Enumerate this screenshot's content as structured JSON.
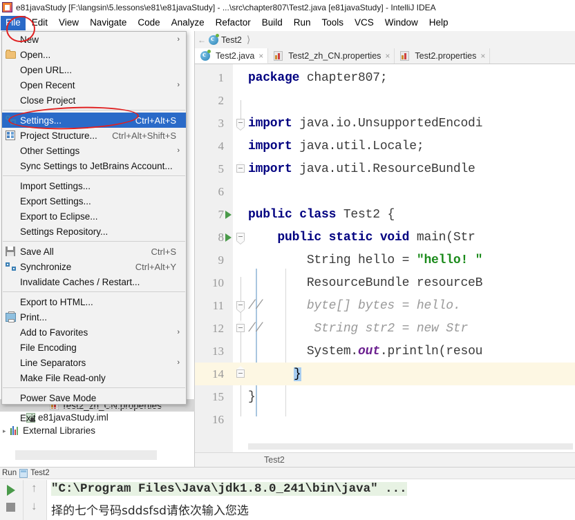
{
  "window": {
    "title": "e81javaStudy [F:\\langsin\\5.lessons\\e81\\e81javaStudy] - ...\\src\\chapter807\\Test2.java [e81javaStudy] - IntelliJ IDEA",
    "app_icon": "intellij-idea-icon"
  },
  "menubar": {
    "items": [
      {
        "label": "File",
        "active": true
      },
      {
        "label": "Edit",
        "active": false
      },
      {
        "label": "View",
        "active": false
      },
      {
        "label": "Navigate",
        "active": false
      },
      {
        "label": "Code",
        "active": false
      },
      {
        "label": "Analyze",
        "active": false
      },
      {
        "label": "Refactor",
        "active": false
      },
      {
        "label": "Build",
        "active": false
      },
      {
        "label": "Run",
        "active": false
      },
      {
        "label": "Tools",
        "active": false
      },
      {
        "label": "VCS",
        "active": false
      },
      {
        "label": "Window",
        "active": false
      },
      {
        "label": "Help",
        "active": false
      }
    ]
  },
  "file_menu": {
    "items": [
      {
        "label": "New",
        "accel": "",
        "arrow": "›",
        "icon": "",
        "selected": false
      },
      {
        "label": "Open...",
        "accel": "",
        "arrow": "",
        "icon": "folder-icon",
        "selected": false
      },
      {
        "label": "Open URL...",
        "accel": "",
        "arrow": "",
        "icon": "",
        "selected": false
      },
      {
        "label": "Open Recent",
        "accel": "",
        "arrow": "›",
        "icon": "",
        "selected": false
      },
      {
        "label": "Close Project",
        "accel": "",
        "arrow": "",
        "icon": "",
        "selected": false
      },
      {
        "label": "SEPARATOR"
      },
      {
        "label": "Settings...",
        "accel": "Ctrl+Alt+S",
        "arrow": "",
        "icon": "settings-icon",
        "selected": true
      },
      {
        "label": "Project Structure...",
        "accel": "Ctrl+Alt+Shift+S",
        "arrow": "",
        "icon": "project-structure-icon",
        "selected": false
      },
      {
        "label": "Other Settings",
        "accel": "",
        "arrow": "›",
        "icon": "",
        "selected": false
      },
      {
        "label": "Sync Settings to JetBrains Account...",
        "accel": "",
        "arrow": "",
        "icon": "",
        "selected": false
      },
      {
        "label": "SEPARATOR"
      },
      {
        "label": "Import Settings...",
        "accel": "",
        "arrow": "",
        "icon": "",
        "selected": false
      },
      {
        "label": "Export Settings...",
        "accel": "",
        "arrow": "",
        "icon": "",
        "selected": false
      },
      {
        "label": "Export to Eclipse...",
        "accel": "",
        "arrow": "",
        "icon": "",
        "selected": false
      },
      {
        "label": "Settings Repository...",
        "accel": "",
        "arrow": "",
        "icon": "",
        "selected": false
      },
      {
        "label": "SEPARATOR"
      },
      {
        "label": "Save All",
        "accel": "Ctrl+S",
        "arrow": "",
        "icon": "save-icon",
        "selected": false
      },
      {
        "label": "Synchronize",
        "accel": "Ctrl+Alt+Y",
        "arrow": "",
        "icon": "synchronize-icon",
        "selected": false
      },
      {
        "label": "Invalidate Caches / Restart...",
        "accel": "",
        "arrow": "",
        "icon": "",
        "selected": false
      },
      {
        "label": "SEPARATOR"
      },
      {
        "label": "Export to HTML...",
        "accel": "",
        "arrow": "",
        "icon": "",
        "selected": false
      },
      {
        "label": "Print...",
        "accel": "",
        "arrow": "",
        "icon": "print-icon",
        "selected": false
      },
      {
        "label": "Add to Favorites",
        "accel": "",
        "arrow": "›",
        "icon": "",
        "selected": false
      },
      {
        "label": "File Encoding",
        "accel": "",
        "arrow": "",
        "icon": "",
        "selected": false
      },
      {
        "label": "Line Separators",
        "accel": "",
        "arrow": "›",
        "icon": "",
        "selected": false
      },
      {
        "label": "Make File Read-only",
        "accel": "",
        "arrow": "",
        "icon": "",
        "selected": false
      },
      {
        "label": "SEPARATOR"
      },
      {
        "label": "Power Save Mode",
        "accel": "",
        "arrow": "",
        "icon": "",
        "selected": false
      },
      {
        "label": "SEPARATOR"
      },
      {
        "label": "Exit",
        "accel": "",
        "arrow": "",
        "icon": "",
        "selected": false
      }
    ]
  },
  "project_tree": {
    "items": [
      {
        "label": "Test2_zh_CN.properties",
        "icon": "properties-file-icon",
        "indent": 72,
        "selected": true
      },
      {
        "label": "e81javaStudy.iml",
        "icon": "module-file-icon",
        "indent": 38,
        "selected": false
      },
      {
        "label": "External Libraries",
        "icon": "libraries-icon",
        "indent": 15,
        "selected": false
      }
    ]
  },
  "editor": {
    "breadcrumb": "Test2",
    "breadcrumb_icon": "java-class-icon",
    "tabs": [
      {
        "label": "Test2.java",
        "icon": "java-class-icon",
        "active": true,
        "close": "×"
      },
      {
        "label": "Test2_zh_CN.properties",
        "icon": "properties-file-icon",
        "active": false,
        "close": "×"
      },
      {
        "label": "Test2.properties",
        "icon": "properties-file-icon",
        "active": false,
        "close": "×"
      }
    ],
    "status_text": "Test2",
    "lines": [
      {
        "n": "1",
        "run": false,
        "fold": "",
        "segs": [
          {
            "t": "package ",
            "c": "kw"
          },
          {
            "t": "chapter807;",
            "c": "id"
          }
        ]
      },
      {
        "n": "2",
        "run": false,
        "fold": "",
        "segs": []
      },
      {
        "n": "3",
        "run": false,
        "fold": "down",
        "segs": [
          {
            "t": "import ",
            "c": "kw"
          },
          {
            "t": "java.io.UnsupportedEncodi",
            "c": "id"
          }
        ]
      },
      {
        "n": "4",
        "run": false,
        "fold": "",
        "segs": [
          {
            "t": "import ",
            "c": "kw"
          },
          {
            "t": "java.util.Locale;",
            "c": "id"
          }
        ]
      },
      {
        "n": "5",
        "run": false,
        "fold": "up",
        "segs": [
          {
            "t": "import ",
            "c": "kw"
          },
          {
            "t": "java.util.ResourceBundle",
            "c": "id"
          }
        ]
      },
      {
        "n": "6",
        "run": false,
        "fold": "",
        "segs": []
      },
      {
        "n": "7",
        "run": true,
        "fold": "",
        "segs": [
          {
            "t": "public class ",
            "c": "kw"
          },
          {
            "t": "Test2 {",
            "c": "id"
          }
        ]
      },
      {
        "n": "8",
        "run": true,
        "fold": "down",
        "segs": [
          {
            "t": "    public static void ",
            "c": "kw"
          },
          {
            "t": "main(Str",
            "c": "id"
          }
        ]
      },
      {
        "n": "9",
        "run": false,
        "fold": "",
        "segs": [
          {
            "t": "        String hello = ",
            "c": "id"
          },
          {
            "t": "\"hello! \"",
            "c": "str"
          }
        ]
      },
      {
        "n": "10",
        "run": false,
        "fold": "",
        "segs": [
          {
            "t": "        ResourceBundle resourceB",
            "c": "id"
          }
        ]
      },
      {
        "n": "11",
        "run": false,
        "fold": "down",
        "segs": [
          {
            "t": "//      byte[] bytes = hello.",
            "c": "cmt"
          }
        ]
      },
      {
        "n": "12",
        "run": false,
        "fold": "up",
        "segs": [
          {
            "t": "//       String str2 = new Str",
            "c": "cmt"
          }
        ]
      },
      {
        "n": "13",
        "run": false,
        "fold": "",
        "segs": [
          {
            "t": "        System.",
            "c": "id"
          },
          {
            "t": "out",
            "c": "fld"
          },
          {
            "t": ".println(resou",
            "c": "id"
          }
        ]
      },
      {
        "n": "14",
        "run": false,
        "fold": "up",
        "highlight": true,
        "caret": "}",
        "segs": []
      },
      {
        "n": "15",
        "run": false,
        "fold": "",
        "segs": [
          {
            "t": "}",
            "c": "id"
          }
        ]
      },
      {
        "n": "16",
        "run": false,
        "fold": "",
        "segs": []
      }
    ]
  },
  "run_panel": {
    "title": "Run",
    "config_name": "Test2",
    "config_icon": "run-configuration-icon",
    "buttons": [
      {
        "name": "rerun-button",
        "icon": "play-icon"
      },
      {
        "name": "stop-button",
        "icon": "stop-icon"
      },
      {
        "name": "up-button",
        "icon": "arrow-up-icon"
      },
      {
        "name": "down-button",
        "icon": "arrow-down-icon"
      }
    ],
    "console_lines": [
      {
        "text": "\"C:\\Program Files\\Java\\jdk1.8.0_241\\bin\\java\" ...",
        "kind": "command"
      },
      {
        "text": "择的七个号码sddsfsd请依次输入您选",
        "kind": "output"
      }
    ]
  },
  "annotations": [
    {
      "name": "file-menu-highlight-circle",
      "color": "#e02020"
    },
    {
      "name": "settings-item-highlight-ellipse",
      "color": "#e02020"
    }
  ],
  "colors": {
    "selection_blue": "#2a6ac8",
    "annotation_red": "#e02020",
    "keyword_navy": "#000080",
    "string_green": "#1a8a1a",
    "comment_gray": "#9a9a9a",
    "field_purple": "#6b1f8f",
    "caret_line_yellow": "#fdf7e3",
    "console_command_bg": "#e7f2e3"
  }
}
